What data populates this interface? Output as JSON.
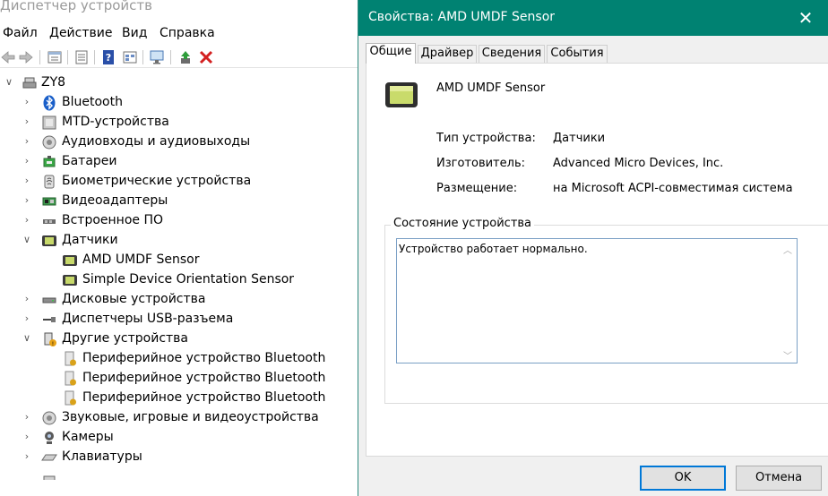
{
  "device_manager": {
    "title": "Диспетчер устройств",
    "menu": [
      "Файл",
      "Действие",
      "Вид",
      "Справка"
    ],
    "toolbar_icons": [
      "back-arrow-icon",
      "forward-arrow-icon",
      "properties-icon",
      "update-driver-icon",
      "help-icon",
      "view-icon",
      "scan-hardware-icon",
      "enable-device-icon",
      "uninstall-icon"
    ],
    "tree": {
      "root": "ZY8",
      "items": [
        {
          "label": "Bluetooth",
          "icon": "bluetooth-icon",
          "level": 1,
          "chevron": "collapsed"
        },
        {
          "label": "MTD-устройства",
          "icon": "mtd-device-icon",
          "level": 1,
          "chevron": "collapsed"
        },
        {
          "label": "Аудиовходы и аудиовыходы",
          "icon": "audio-io-icon",
          "level": 1,
          "chevron": "collapsed"
        },
        {
          "label": "Батареи",
          "icon": "battery-icon",
          "level": 1,
          "chevron": "collapsed"
        },
        {
          "label": "Биометрические устройства",
          "icon": "fingerprint-icon",
          "level": 1,
          "chevron": "collapsed"
        },
        {
          "label": "Видеоадаптеры",
          "icon": "display-adapter-icon",
          "level": 1,
          "chevron": "collapsed"
        },
        {
          "label": "Встроенное ПО",
          "icon": "firmware-icon",
          "level": 1,
          "chevron": "collapsed"
        },
        {
          "label": "Датчики",
          "icon": "sensor-icon",
          "level": 1,
          "chevron": "expanded"
        },
        {
          "label": "AMD UMDF Sensor",
          "icon": "sensor-icon",
          "level": 2,
          "chevron": "none"
        },
        {
          "label": "Simple Device Orientation Sensor",
          "icon": "sensor-icon",
          "level": 2,
          "chevron": "none"
        },
        {
          "label": "Дисковые устройства",
          "icon": "disk-drive-icon",
          "level": 1,
          "chevron": "collapsed"
        },
        {
          "label": "Диспетчеры USB-разъема",
          "icon": "usb-connector-icon",
          "level": 1,
          "chevron": "collapsed"
        },
        {
          "label": "Другие устройства",
          "icon": "other-devices-icon",
          "level": 1,
          "chevron": "expanded"
        },
        {
          "label": "Периферийное устройство Bluetooth",
          "icon": "unknown-device-icon",
          "level": 2,
          "chevron": "none"
        },
        {
          "label": "Периферийное устройство Bluetooth",
          "icon": "unknown-device-icon",
          "level": 2,
          "chevron": "none"
        },
        {
          "label": "Периферийное устройство Bluetooth",
          "icon": "unknown-device-icon",
          "level": 2,
          "chevron": "none"
        },
        {
          "label": "Звуковые, игровые и видеоустройства",
          "icon": "sound-device-icon",
          "level": 1,
          "chevron": "collapsed"
        },
        {
          "label": "Камеры",
          "icon": "camera-icon",
          "level": 1,
          "chevron": "collapsed"
        },
        {
          "label": "Клавиатуры",
          "icon": "keyboard-icon",
          "level": 1,
          "chevron": "collapsed"
        }
      ]
    }
  },
  "dialog": {
    "title": "Свойства: AMD UMDF Sensor",
    "tabs": [
      "Общие",
      "Драйвер",
      "Сведения",
      "События"
    ],
    "active_tab": "Общие",
    "device_name": "AMD UMDF Sensor",
    "properties": [
      {
        "label": "Тип устройства:",
        "value": "Датчики"
      },
      {
        "label": "Изготовитель:",
        "value": "Advanced Micro Devices, Inc."
      },
      {
        "label": "Размещение:",
        "value": "на Microsoft ACPI-совместимая система"
      }
    ],
    "status_group_title": "Состояние устройства",
    "status_text": "Устройство работает нормально.",
    "ok_label": "OK",
    "cancel_label": "Отмена",
    "accent_color": "#008272"
  }
}
